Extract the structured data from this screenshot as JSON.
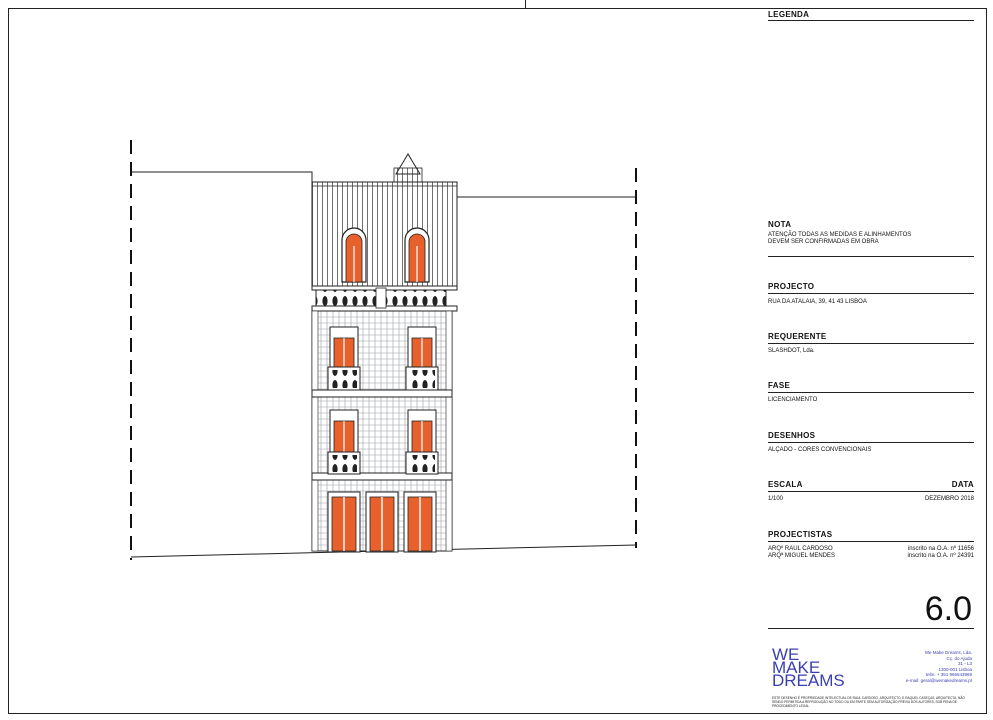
{
  "legenda": {
    "title": "LEGENDA"
  },
  "nota": {
    "title": "NOTA",
    "text_1": "ATENÇÃO TODAS AS MEDIDAS E ALINHAMENTOS",
    "text_2": "DEVEM SER CONFIRMADAS EM OBRA"
  },
  "projecto": {
    "title": "PROJECTO",
    "value": "RUA DA ATALAIA, 39, 41 43 LISBOA"
  },
  "requerente": {
    "title": "REQUERENTE",
    "value": "SLASHDOT, Lda."
  },
  "fase": {
    "title": "FASE",
    "value": "LICENCIAMENTO"
  },
  "desenhos": {
    "title": "DESENHOS",
    "value": "ALÇADO - CORES CONVENCIONAIS"
  },
  "escala": {
    "title": "ESCALA",
    "value": "1/100",
    "data_title": "DATA",
    "data_value": "DEZEMBRO 2018"
  },
  "projectistas": {
    "title": "PROJECTISTAS",
    "people": [
      {
        "name": "ARQº RAUL CARDOSO",
        "reg": "inscrito na O.A. nº 11656"
      },
      {
        "name": "ARQª MIGUEL MENDES",
        "reg": "inscrito na O.A. nº 24391"
      }
    ]
  },
  "sheet_number": "6.0",
  "logo": {
    "line1": "WE",
    "line2": "MAKE",
    "line3": "DREAMS"
  },
  "address": [
    "We Make Dreams, Lda.",
    "Cç. do Ajuda",
    "31 - L3",
    "1300-001 Lisboa",
    "telm. + 351 966543969",
    "e-mail: geral@wemakedreams.pt"
  ],
  "disclaimer": "ESTE DESENHO É PROPRIEDADE INTELECTUAL DE RAUL CARDOSO, ARQUITECTO, E RAQUEL CASEÇAS, ARQUITECTA, NÃO SENDO PERMITIDA A REPRODUÇÃO NO TODO OU EM PARTE SEM AUTORIZAÇÃO PRÉVIA DOS AUTORES, SOB PENA DE PROCEDIMENTO LEGAL",
  "colors": {
    "line": "#222222",
    "door_fill": "#e8612c",
    "logo": "#3b3fb0"
  }
}
